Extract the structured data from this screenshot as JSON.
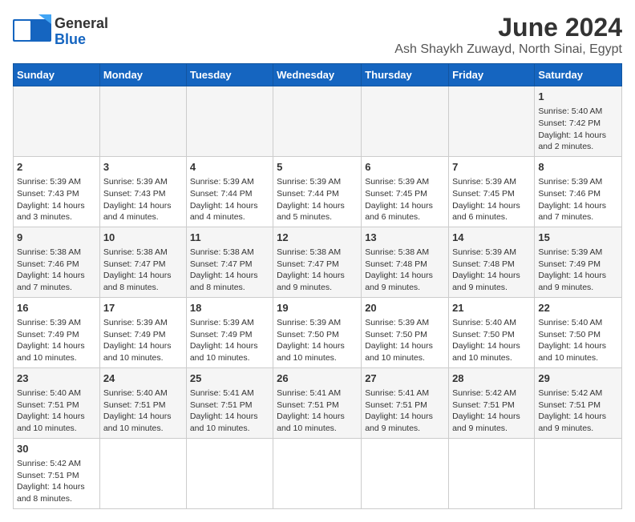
{
  "header": {
    "logo_general": "General",
    "logo_blue": "Blue",
    "title": "June 2024",
    "subtitle": "Ash Shaykh Zuwayd, North Sinai, Egypt"
  },
  "days_of_week": [
    "Sunday",
    "Monday",
    "Tuesday",
    "Wednesday",
    "Thursday",
    "Friday",
    "Saturday"
  ],
  "weeks": [
    [
      {
        "day": null,
        "content": ""
      },
      {
        "day": null,
        "content": ""
      },
      {
        "day": null,
        "content": ""
      },
      {
        "day": null,
        "content": ""
      },
      {
        "day": null,
        "content": ""
      },
      {
        "day": null,
        "content": ""
      },
      {
        "day": 1,
        "content": "Sunrise: 5:40 AM\nSunset: 7:42 PM\nDaylight: 14 hours and 2 minutes."
      }
    ],
    [
      {
        "day": 2,
        "content": "Sunrise: 5:39 AM\nSunset: 7:43 PM\nDaylight: 14 hours and 3 minutes."
      },
      {
        "day": 3,
        "content": "Sunrise: 5:39 AM\nSunset: 7:43 PM\nDaylight: 14 hours and 4 minutes."
      },
      {
        "day": 4,
        "content": "Sunrise: 5:39 AM\nSunset: 7:44 PM\nDaylight: 14 hours and 4 minutes."
      },
      {
        "day": 5,
        "content": "Sunrise: 5:39 AM\nSunset: 7:44 PM\nDaylight: 14 hours and 5 minutes."
      },
      {
        "day": 6,
        "content": "Sunrise: 5:39 AM\nSunset: 7:45 PM\nDaylight: 14 hours and 6 minutes."
      },
      {
        "day": 7,
        "content": "Sunrise: 5:39 AM\nSunset: 7:45 PM\nDaylight: 14 hours and 6 minutes."
      },
      {
        "day": 8,
        "content": "Sunrise: 5:39 AM\nSunset: 7:46 PM\nDaylight: 14 hours and 7 minutes."
      }
    ],
    [
      {
        "day": 9,
        "content": "Sunrise: 5:38 AM\nSunset: 7:46 PM\nDaylight: 14 hours and 7 minutes."
      },
      {
        "day": 10,
        "content": "Sunrise: 5:38 AM\nSunset: 7:47 PM\nDaylight: 14 hours and 8 minutes."
      },
      {
        "day": 11,
        "content": "Sunrise: 5:38 AM\nSunset: 7:47 PM\nDaylight: 14 hours and 8 minutes."
      },
      {
        "day": 12,
        "content": "Sunrise: 5:38 AM\nSunset: 7:47 PM\nDaylight: 14 hours and 9 minutes."
      },
      {
        "day": 13,
        "content": "Sunrise: 5:38 AM\nSunset: 7:48 PM\nDaylight: 14 hours and 9 minutes."
      },
      {
        "day": 14,
        "content": "Sunrise: 5:39 AM\nSunset: 7:48 PM\nDaylight: 14 hours and 9 minutes."
      },
      {
        "day": 15,
        "content": "Sunrise: 5:39 AM\nSunset: 7:49 PM\nDaylight: 14 hours and 9 minutes."
      }
    ],
    [
      {
        "day": 16,
        "content": "Sunrise: 5:39 AM\nSunset: 7:49 PM\nDaylight: 14 hours and 10 minutes."
      },
      {
        "day": 17,
        "content": "Sunrise: 5:39 AM\nSunset: 7:49 PM\nDaylight: 14 hours and 10 minutes."
      },
      {
        "day": 18,
        "content": "Sunrise: 5:39 AM\nSunset: 7:49 PM\nDaylight: 14 hours and 10 minutes."
      },
      {
        "day": 19,
        "content": "Sunrise: 5:39 AM\nSunset: 7:50 PM\nDaylight: 14 hours and 10 minutes."
      },
      {
        "day": 20,
        "content": "Sunrise: 5:39 AM\nSunset: 7:50 PM\nDaylight: 14 hours and 10 minutes."
      },
      {
        "day": 21,
        "content": "Sunrise: 5:40 AM\nSunset: 7:50 PM\nDaylight: 14 hours and 10 minutes."
      },
      {
        "day": 22,
        "content": "Sunrise: 5:40 AM\nSunset: 7:50 PM\nDaylight: 14 hours and 10 minutes."
      }
    ],
    [
      {
        "day": 23,
        "content": "Sunrise: 5:40 AM\nSunset: 7:51 PM\nDaylight: 14 hours and 10 minutes."
      },
      {
        "day": 24,
        "content": "Sunrise: 5:40 AM\nSunset: 7:51 PM\nDaylight: 14 hours and 10 minutes."
      },
      {
        "day": 25,
        "content": "Sunrise: 5:41 AM\nSunset: 7:51 PM\nDaylight: 14 hours and 10 minutes."
      },
      {
        "day": 26,
        "content": "Sunrise: 5:41 AM\nSunset: 7:51 PM\nDaylight: 14 hours and 10 minutes."
      },
      {
        "day": 27,
        "content": "Sunrise: 5:41 AM\nSunset: 7:51 PM\nDaylight: 14 hours and 9 minutes."
      },
      {
        "day": 28,
        "content": "Sunrise: 5:42 AM\nSunset: 7:51 PM\nDaylight: 14 hours and 9 minutes."
      },
      {
        "day": 29,
        "content": "Sunrise: 5:42 AM\nSunset: 7:51 PM\nDaylight: 14 hours and 9 minutes."
      }
    ],
    [
      {
        "day": 30,
        "content": "Sunrise: 5:42 AM\nSunset: 7:51 PM\nDaylight: 14 hours and 8 minutes."
      },
      {
        "day": null,
        "content": ""
      },
      {
        "day": null,
        "content": ""
      },
      {
        "day": null,
        "content": ""
      },
      {
        "day": null,
        "content": ""
      },
      {
        "day": null,
        "content": ""
      },
      {
        "day": null,
        "content": ""
      }
    ]
  ]
}
